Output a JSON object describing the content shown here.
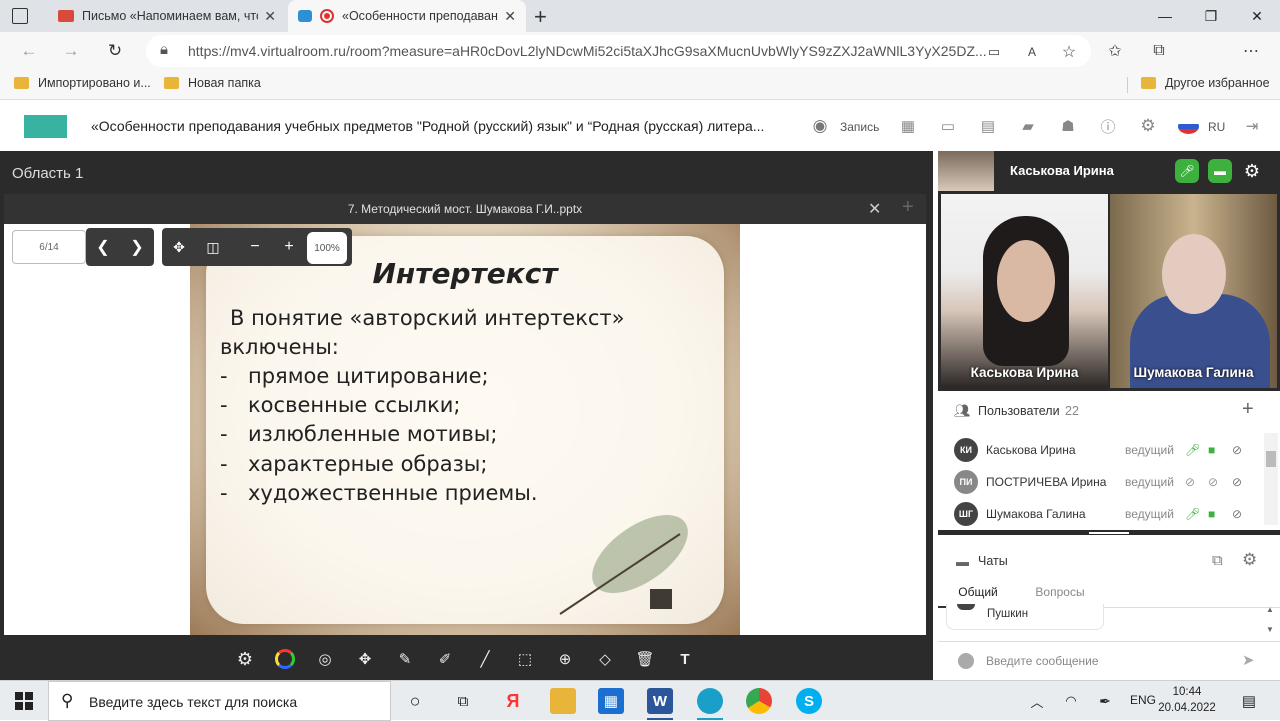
{
  "browser": {
    "tabs": [
      {
        "title": "Письмо «Напоминаем вам, что ве",
        "close": "✕"
      },
      {
        "title": "«Особенности преподавания",
        "close": "✕"
      }
    ],
    "new_tab": "+",
    "window_controls": {
      "minimize": "—",
      "maximize": "❐",
      "close": "✕"
    },
    "url": "https://mv4.virtualroom.ru/room?measure=aHR0cDovL2lyNDcwMi52ci5taXJhcG9saXMucnUvbWlyYS9zZXJ2aWNlL3YyX25DZ...",
    "favorites": [
      {
        "label": "Импортировано и..."
      },
      {
        "label": "Новая папка"
      },
      {
        "label": "Другое избранное"
      }
    ]
  },
  "app": {
    "room_title": "«Особенности преподавания учебных предметов \"Родной (русский) язык\" и “Родная (русская) литера...",
    "record_label": "Запись",
    "language": "RU",
    "area_label": "Область 1",
    "presentation": {
      "file_name": "7. Методический мост. Шумакова Г.И..pptx",
      "page": "6/14",
      "zoom": "100%",
      "close": "✕",
      "add": "+"
    },
    "slide": {
      "title": "Интертекст",
      "lines": [
        {
          "dash": "",
          "text": "В понятие «авторский  интертекст»"
        },
        {
          "dash": "",
          "text": "включены:"
        },
        {
          "dash": "-",
          "text": "прямое цитирование;"
        },
        {
          "dash": "-",
          "text": "косвенные ссылки;"
        },
        {
          "dash": "-",
          "text": "излюбленные мотивы;"
        },
        {
          "dash": "-",
          "text": "характерные образы;"
        },
        {
          "dash": "-",
          "text": "художественные приемы."
        }
      ]
    },
    "tools": [
      "gear-icon",
      "color-icon",
      "pointer-icon",
      "move-icon",
      "brush-icon",
      "pencil-icon",
      "line-icon",
      "crop-icon",
      "shape-icon",
      "eraser-icon",
      "trash-icon",
      "text-icon"
    ]
  },
  "panel": {
    "speaker_name": "Каськова Ирина",
    "videos": [
      {
        "name": "Каськова Ирина"
      },
      {
        "name": "Шумакова Галина"
      }
    ],
    "users_label": "Пользователи",
    "users_count": "22",
    "users": [
      {
        "initials": "КИ",
        "name": "Каськова Ирина",
        "role": "ведущий",
        "mic": "on",
        "cam": "on"
      },
      {
        "initials": "ПИ",
        "name": "ПОСТРИЧЕВА Ирина",
        "role": "ведущий",
        "mic": "off",
        "cam": "off"
      },
      {
        "initials": "ШГ",
        "name": "Шумакова Галина",
        "role": "ведущий",
        "mic": "on",
        "cam": "on"
      }
    ],
    "chats_label": "Чаты",
    "chat_tabs": [
      {
        "label": "Общий"
      },
      {
        "label": "Вопросы"
      }
    ],
    "chat_message": "Пушкин",
    "chat_placeholder": "Введите сообщение"
  },
  "taskbar": {
    "search_placeholder": "Введите здесь текст для поиска",
    "language": "ENG",
    "time": "10:44",
    "date": "20.04.2022"
  },
  "colors": {
    "accent_green": "#3db03d",
    "logo_teal": "#39b3a1",
    "dark_bg": "#2b2b2b"
  }
}
